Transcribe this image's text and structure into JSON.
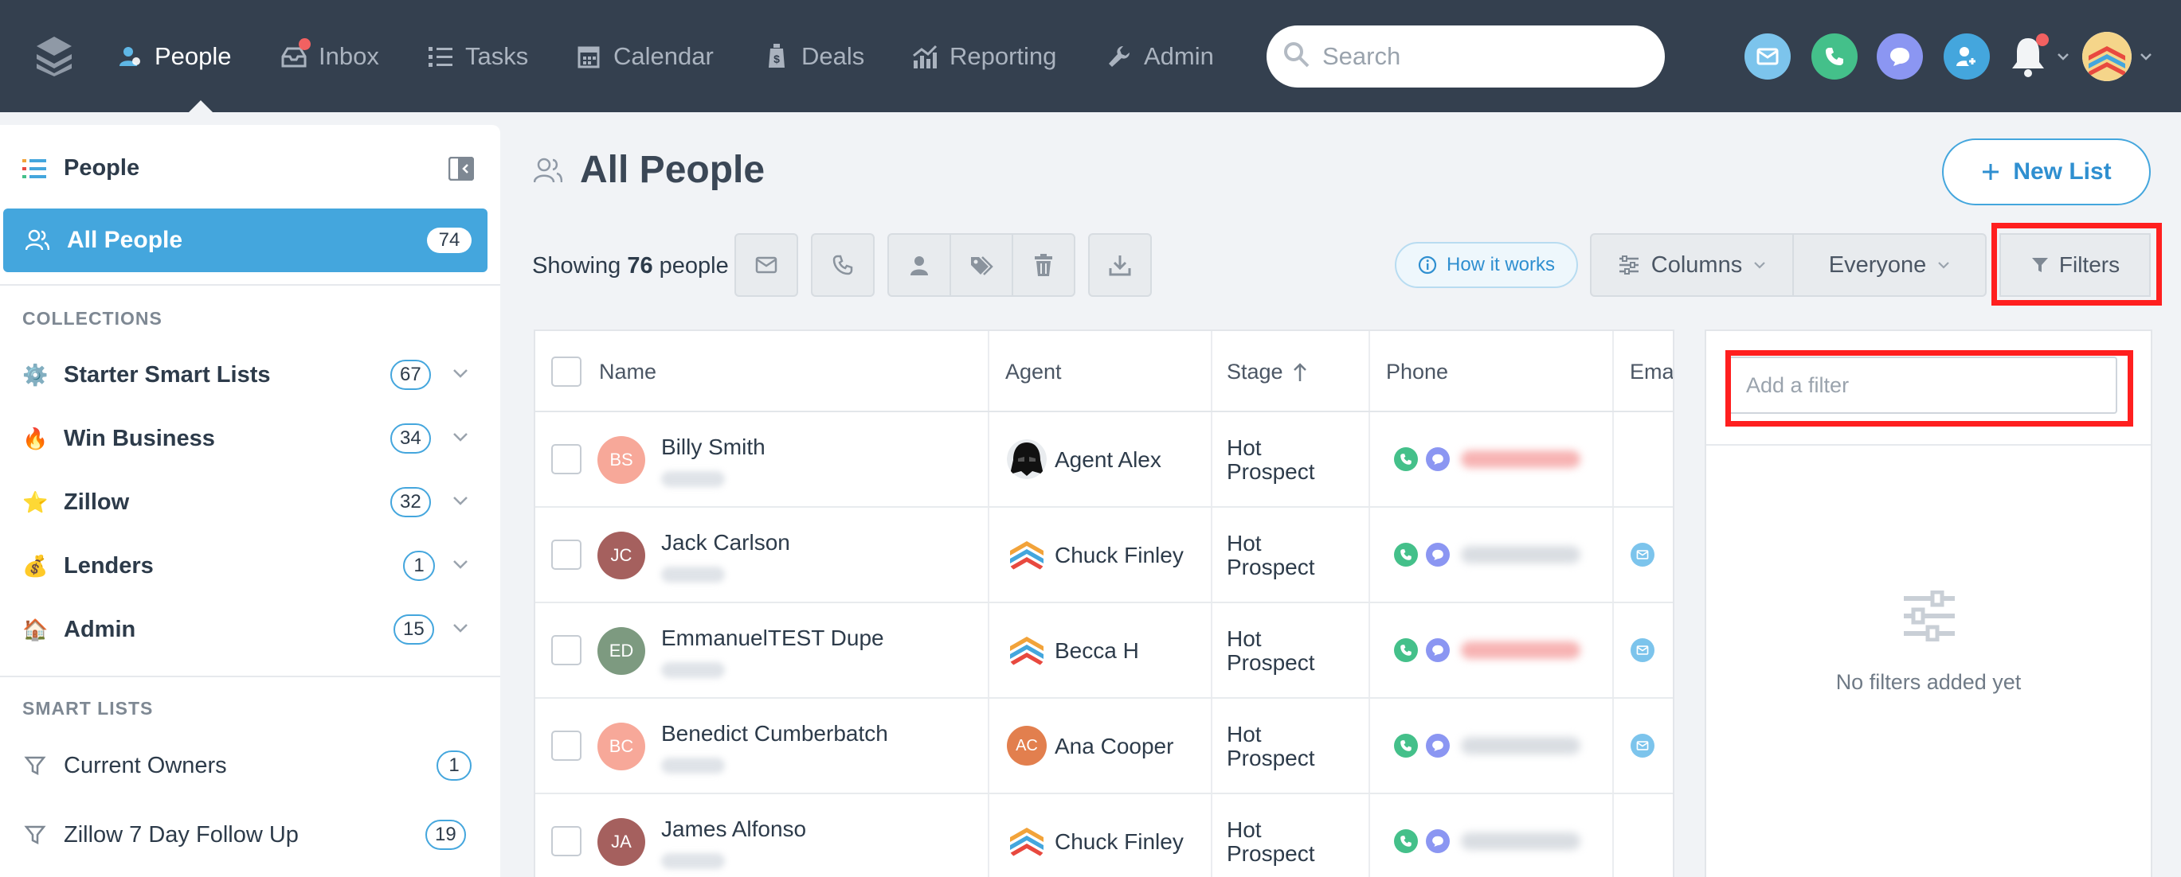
{
  "nav": {
    "items": [
      {
        "label": "People",
        "icon": "people-icon",
        "active": true
      },
      {
        "label": "Inbox",
        "icon": "inbox-icon",
        "badge": true
      },
      {
        "label": "Tasks",
        "icon": "tasks-icon"
      },
      {
        "label": "Calendar",
        "icon": "calendar-icon"
      },
      {
        "label": "Deals",
        "icon": "deals-icon"
      },
      {
        "label": "Reporting",
        "icon": "reporting-icon"
      },
      {
        "label": "Admin",
        "icon": "wrench-icon"
      }
    ],
    "search_placeholder": "Search",
    "quick_actions": [
      {
        "name": "email-icon",
        "color": "#7cc4ec"
      },
      {
        "name": "phone-icon",
        "color": "#44c08a"
      },
      {
        "name": "chat-icon",
        "color": "#8b96f2"
      },
      {
        "name": "add-person-icon",
        "color": "#44a6dd"
      }
    ]
  },
  "sidebar": {
    "title": "People",
    "all_people": {
      "label": "All People",
      "count": "74"
    },
    "collections_header": "COLLECTIONS",
    "collections": [
      {
        "label": "Starter Smart Lists",
        "icon": "gear-icon",
        "emoji": "⚙️",
        "count": "67"
      },
      {
        "label": "Win Business",
        "icon": "fire-icon",
        "emoji": "🔥",
        "count": "34"
      },
      {
        "label": "Zillow",
        "icon": "star-icon",
        "emoji": "⭐",
        "count": "32"
      },
      {
        "label": "Lenders",
        "icon": "money-bag-icon",
        "emoji": "💰",
        "count": "1"
      },
      {
        "label": "Admin",
        "icon": "house-icon",
        "emoji": "🏠",
        "count": "15"
      }
    ],
    "smart_lists_header": "SMART LISTS",
    "smart_lists": [
      {
        "label": "Current Owners",
        "count": "1"
      },
      {
        "label": "Zillow 7 Day Follow Up",
        "count": "19"
      }
    ]
  },
  "main": {
    "title": "All People",
    "new_list_label": "New List",
    "showing_prefix": "Showing",
    "showing_count": "76",
    "showing_suffix": "people",
    "how_it_works_label": "How it works",
    "columns_label": "Columns",
    "everyone_label": "Everyone",
    "filters_label": "Filters"
  },
  "table": {
    "headers": {
      "name": "Name",
      "agent": "Agent",
      "stage": "Stage",
      "phone": "Phone",
      "email": "Emai"
    },
    "rows": [
      {
        "initials": "BS",
        "name": "Billy Smith",
        "avatar_color": "#f7a899",
        "agent": "Agent Alex",
        "agent_avatar": "vader",
        "stage_line1": "Hot",
        "stage_line2": "Prospect",
        "phone_color": "#f7b3b3",
        "has_email": false
      },
      {
        "initials": "JC",
        "name": "Jack Carlson",
        "avatar_color": "#a5605e",
        "agent": "Chuck Finley",
        "agent_avatar": "logo",
        "stage_line1": "Hot",
        "stage_line2": "Prospect",
        "phone_color": "#d9dde2",
        "has_email": true
      },
      {
        "initials": "ED",
        "name": "EmmanuelTEST Dupe",
        "avatar_color": "#7d9a80",
        "agent": "Becca H",
        "agent_avatar": "logo",
        "stage_line1": "Hot",
        "stage_line2": "Prospect",
        "phone_color": "#f7b3b3",
        "has_email": true
      },
      {
        "initials": "BC",
        "name": "Benedict Cumberbatch",
        "avatar_color": "#f7a899",
        "agent": "Ana Cooper",
        "agent_avatar": "initials",
        "agent_initials": "AC",
        "stage_line1": "Hot",
        "stage_line2": "Prospect",
        "phone_color": "#d9dde2",
        "has_email": true
      },
      {
        "initials": "JA",
        "name": "James Alfonso",
        "avatar_color": "#a5605e",
        "agent": "Chuck Finley",
        "agent_avatar": "logo",
        "stage_line1": "Hot",
        "stage_line2": "Prospect",
        "phone_color": "#d9dde2",
        "has_email": false
      }
    ]
  },
  "filter_panel": {
    "input_placeholder": "Add a filter",
    "empty_text": "No filters added yet"
  },
  "colors": {
    "topbar": "#34404f",
    "accent": "#44a6dd",
    "highlight": "#ff1f1f"
  }
}
